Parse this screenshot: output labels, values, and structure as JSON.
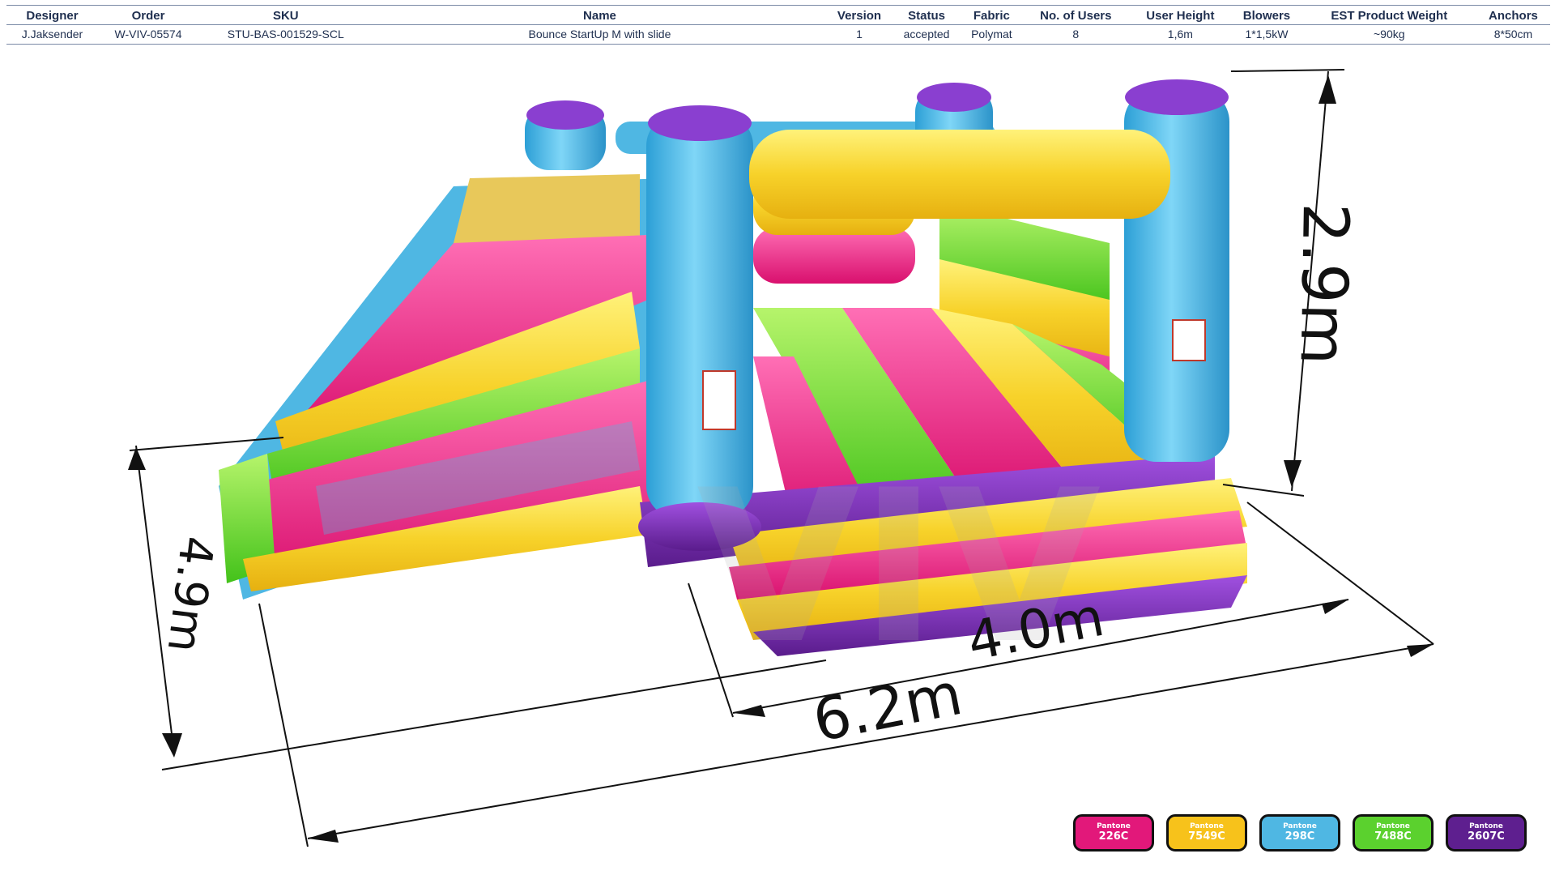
{
  "spec": {
    "headers": [
      "Designer",
      "Order",
      "SKU",
      "Name",
      "Version",
      "Status",
      "Fabric",
      "No. of Users",
      "User  Height",
      "Blowers",
      "EST Product Weight",
      "Anchors"
    ],
    "values": [
      "J.Jaksender",
      "W-VIV-05574",
      "STU-BAS-001529-SCL",
      "Bounce StartUp M with slide",
      "1",
      "accepted",
      "Polymat",
      "8",
      "1,6m",
      "1*1,5kW",
      "~90kg",
      "8*50cm"
    ]
  },
  "dimensions": {
    "height": "2.9m",
    "width_left": "4.9m",
    "front_short": "4.0m",
    "front_long": "6.2m"
  },
  "watermark": "VIV",
  "swatches": [
    {
      "brand": "Pantone",
      "code": "226C",
      "color": "#e2187a"
    },
    {
      "brand": "Pantone",
      "code": "7549C",
      "color": "#f7c21b"
    },
    {
      "brand": "Pantone",
      "code": "298C",
      "color": "#4fb7e3"
    },
    {
      "brand": "Pantone",
      "code": "7488C",
      "color": "#5bd12e"
    },
    {
      "brand": "Pantone",
      "code": "2607C",
      "color": "#5e1f8f"
    }
  ]
}
